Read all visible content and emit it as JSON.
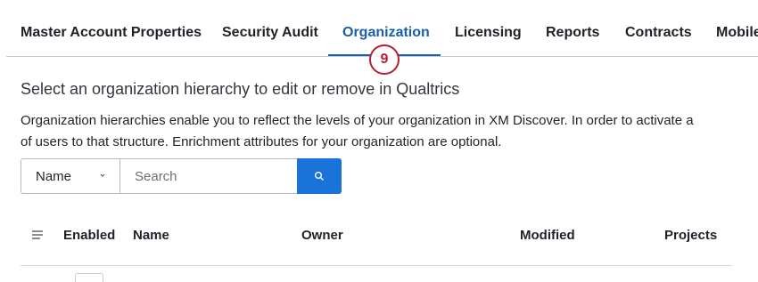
{
  "tabs": [
    {
      "label": "Master Account Properties",
      "active": false
    },
    {
      "label": "Security Audit",
      "active": false
    },
    {
      "label": "Organization",
      "active": true
    },
    {
      "label": "Licensing",
      "active": false
    },
    {
      "label": "Reports",
      "active": false
    },
    {
      "label": "Contracts",
      "active": false
    },
    {
      "label": "Mobile",
      "active": false
    }
  ],
  "step_badge": "9",
  "heading": "Select an organization hierarchy to edit or remove in Qualtrics",
  "description": {
    "line1": "Organization hierarchies enable you to reflect the levels of your organization in XM Discover. In order to activate a",
    "line2": "of users to that structure. Enrichment attributes for your organization are optional."
  },
  "filter": {
    "selected": "Name"
  },
  "search": {
    "placeholder": "Search",
    "value": ""
  },
  "table": {
    "columns": [
      "Enabled",
      "Name",
      "Owner",
      "Modified",
      "Projects"
    ]
  },
  "icons": {
    "search_button": "search-icon",
    "filter_chevron": "chevron-down-icon",
    "column_menu": "menu-icon"
  },
  "colors": {
    "accent": "#1a5fa8",
    "button": "#1a73d9",
    "badge": "#b51f32"
  }
}
